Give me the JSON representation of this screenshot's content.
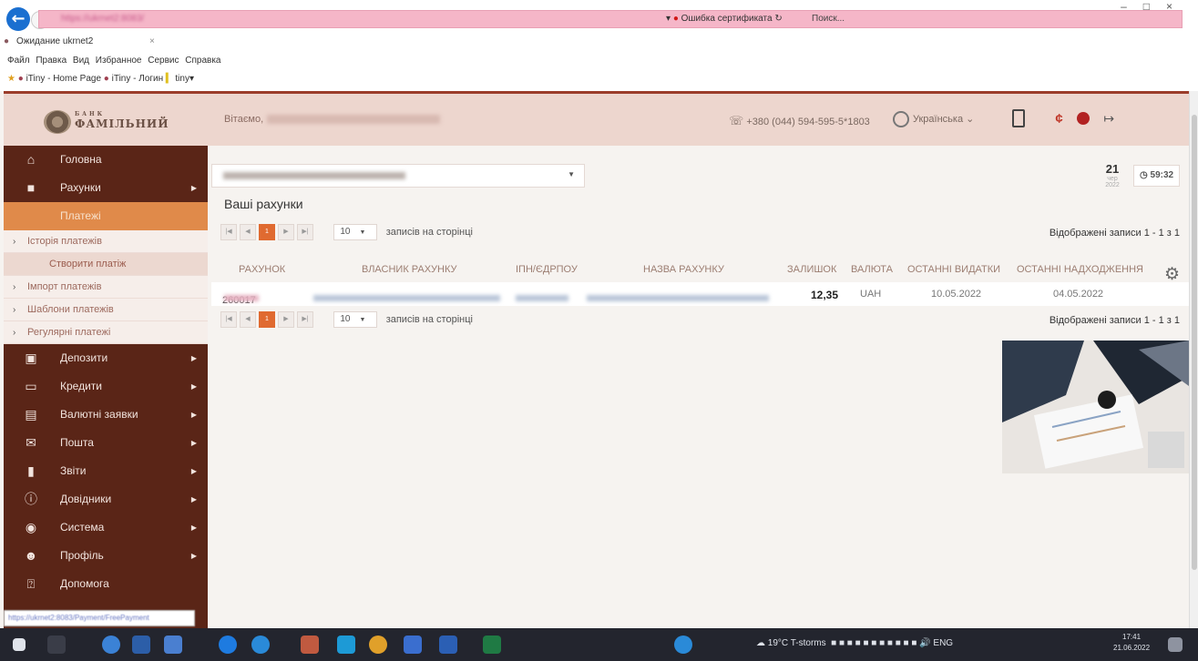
{
  "browser": {
    "address": "https://ukrnet2:8083/",
    "cert_error": "Ошибка сертификата",
    "search_placeholder": "Поиск...",
    "tab_title": "Ожидание ukrnet2",
    "menu": "Файл  Правка  Вид  Избранное  Сервис  Справка",
    "favorites": [
      "iTiny - Home Page",
      "iTiny - Логин",
      "tiny"
    ]
  },
  "header": {
    "logo_top": "БАНК",
    "logo_name": "ФАМІЛЬНИЙ",
    "welcome": "Вітаємо,",
    "phone": "+380 (044) 594-595-5*1803",
    "language": "Українська"
  },
  "sidebar": {
    "items": [
      {
        "label": "Головна",
        "icon": "home-icon"
      },
      {
        "label": "Рахунки",
        "icon": "wallet-icon"
      },
      {
        "label": "Платежі",
        "icon": "payments-icon"
      },
      {
        "label": "Депозити",
        "icon": "deposit-icon"
      },
      {
        "label": "Кредити",
        "icon": "credit-icon"
      },
      {
        "label": "Валютні заявки",
        "icon": "currency-icon"
      },
      {
        "label": "Пошта",
        "icon": "mail-icon"
      },
      {
        "label": "Звіти",
        "icon": "chart-icon"
      },
      {
        "label": "Довідники",
        "icon": "info-icon"
      },
      {
        "label": "Система",
        "icon": "system-icon"
      },
      {
        "label": "Профіль",
        "icon": "user-icon"
      },
      {
        "label": "Допомога",
        "icon": "help-icon"
      }
    ],
    "payments_sub": [
      "Історія платежів",
      "Створити платіж",
      "Імпорт платежів",
      "Шаблони платежів",
      "Регулярні платежі"
    ]
  },
  "main": {
    "date_day": "21",
    "date_month": "чер",
    "date_year": "2022",
    "timer": "59:32",
    "title": "Ваші рахунки",
    "page_current": "1",
    "per_page": "10",
    "per_page_label": "записів на сторінці",
    "shown_top": "Відображені записи 1 - 1 з 1",
    "shown_bottom": "Відображені записи 1 - 1 з 1",
    "columns": [
      "РАХУНОК",
      "ВЛАСНИК РАХУНКУ",
      "ІПН/ЄДРПОУ",
      "НАЗВА РАХУНКУ",
      "ЗАЛИШОК",
      "ВАЛЮТА",
      "ОСТАННІ ВИДАТКИ",
      "ОСТАННІ НАДХОДЖЕННЯ"
    ],
    "rows": [
      {
        "account": "260017",
        "balance": "12,35",
        "currency": "UAH",
        "last_expense": "10.05.2022",
        "last_income": "04.05.2022"
      }
    ]
  },
  "status_url": "https://ukrnet2:8083/Payment/FreePayment",
  "taskbar": {
    "weather": "19°C T-storms",
    "lang": "ENG",
    "time": "17:41",
    "date": "21.06.2022"
  }
}
